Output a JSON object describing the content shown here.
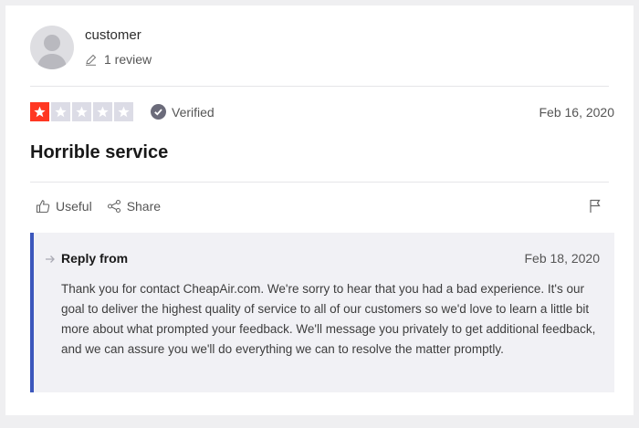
{
  "reviewer": {
    "name": "customer",
    "review_count": "1 review"
  },
  "rating": {
    "stars": 1,
    "max_stars": 5,
    "verified_label": "Verified",
    "date": "Feb 16, 2020"
  },
  "review": {
    "title": "Horrible service"
  },
  "actions": {
    "useful_label": "Useful",
    "share_label": "Share"
  },
  "reply": {
    "from_label": "Reply from",
    "date": "Feb 18, 2020",
    "body": "Thank you for contact CheapAir.com. We're sorry to hear that you had a bad experience. It's our goal to deliver the highest quality of service to all of our customers so we'd love to learn a little bit more about what prompted your feedback. We'll message you privately to get additional feedback, and we can assure you we'll do everything we can to resolve the matter promptly."
  },
  "colors": {
    "star_on": "#ff3722",
    "star_off": "#dcdce6",
    "reply_accent": "#3c57bc",
    "reply_bg": "#f1f1f5"
  }
}
